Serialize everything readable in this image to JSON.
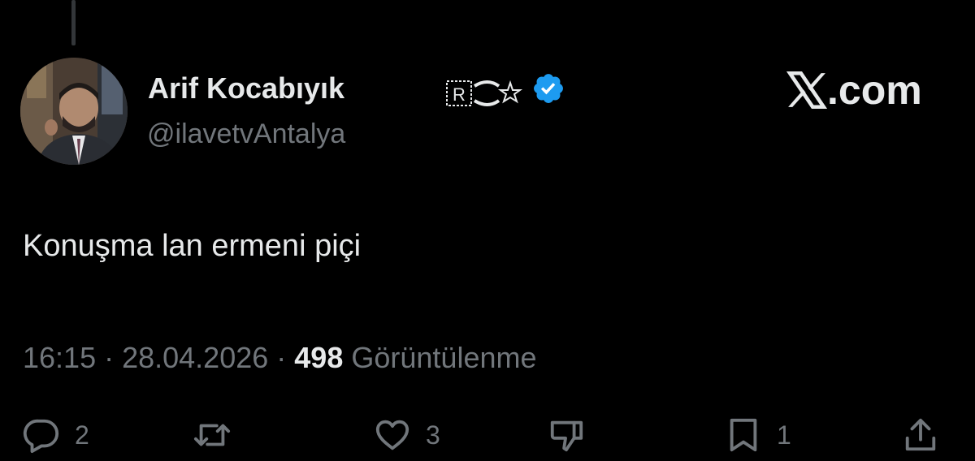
{
  "author": {
    "display_name": "Arif Kocabıyık",
    "handle": "@ilavetvAntalya",
    "affiliation_badge_letter": "R",
    "verified": true,
    "verified_color": "#1d9bf0"
  },
  "brand": {
    "logo_text": ".com",
    "logo_icon": "x-logo-icon"
  },
  "tweet": {
    "text": "Konuşma lan ermeni piçi",
    "time": "16:15",
    "separator_1": " · ",
    "date": "28.04.2026",
    "separator_2": " · ",
    "views": "498",
    "views_label": " Görüntülenme"
  },
  "actions": {
    "reply_count": "2",
    "retweet_count": "",
    "like_count": "3",
    "bookmark_count": "1"
  },
  "colors": {
    "background": "#000000",
    "primary_text": "#e7e9ea",
    "secondary_text": "#71767b",
    "verified_blue": "#1d9bf0"
  }
}
